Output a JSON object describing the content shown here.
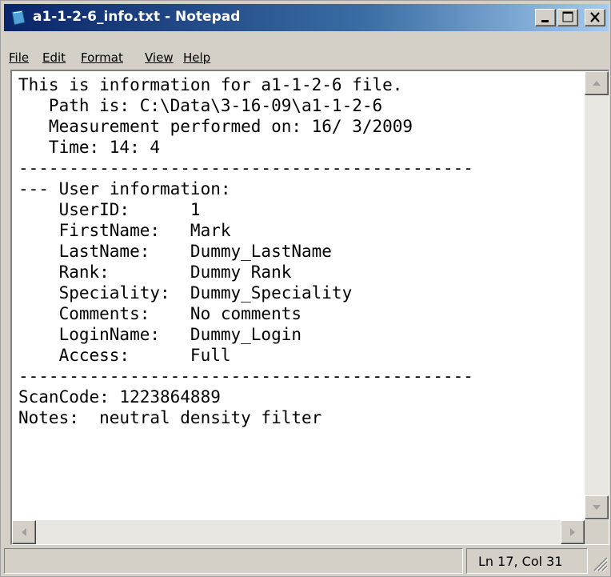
{
  "window": {
    "title": "a1-1-2-6_info.txt - Notepad"
  },
  "title_buttons": [
    "minimize",
    "maximize",
    "close"
  ],
  "menu": [
    {
      "label": "File"
    },
    {
      "label": "Edit"
    },
    {
      "label": "Format"
    },
    {
      "label": "View"
    },
    {
      "label": "Help"
    }
  ],
  "document": {
    "lines": [
      "This is information for a1-1-2-6 file.",
      "   Path is: C:\\Data\\3-16-09\\a1-1-2-6",
      "   Measurement performed on: 16/ 3/2009",
      "   Time: 14: 4",
      "---------------------------------------------",
      "--- User information:",
      "    UserID:      1",
      "    FirstName:   Mark",
      "    LastName:    Dummy_LastName",
      "    Rank:        Dummy Rank",
      "    Speciality:  Dummy_Speciality",
      "    Comments:    No comments",
      "    LoginName:   Dummy_Login",
      "    Access:      Full",
      "---------------------------------------------",
      "ScanCode: 1223864889",
      "Notes:  neutral density filter"
    ]
  },
  "status": {
    "left": "",
    "position": "Ln 17, Col 31"
  },
  "colors": {
    "titlebar_start": "#0a246a",
    "titlebar_end": "#a6caf0",
    "chrome": "#d4d0c8",
    "editor_bg": "#ffffff"
  },
  "icons": [
    "notepad-icon",
    "minimize-icon",
    "maximize-icon",
    "close-icon",
    "scroll-up-icon",
    "scroll-down-icon",
    "scroll-left-icon",
    "scroll-right-icon",
    "size-grip-icon"
  ]
}
